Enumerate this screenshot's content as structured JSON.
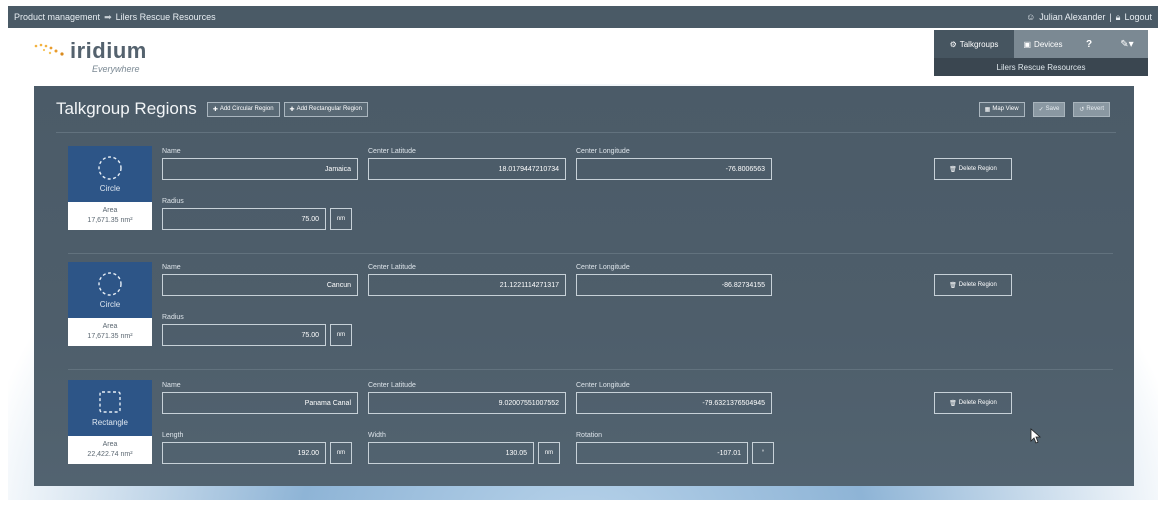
{
  "topbar": {
    "breadcrumb_left": "Product management",
    "breadcrumb_sep": "➡",
    "breadcrumb_right": "Lilers Rescue Resources",
    "user_name": "Julian Alexander",
    "separator": "|",
    "logout": "Logout"
  },
  "logo": {
    "brand": "iridium",
    "tagline": "Everywhere"
  },
  "nav": {
    "tabs": [
      {
        "label": "Talkgroups",
        "icon": "gear-icon"
      },
      {
        "label": "Devices",
        "icon": "devices-icon"
      },
      {
        "label": "",
        "icon": "help-icon"
      },
      {
        "label": "",
        "icon": "wrench-icon"
      }
    ],
    "context": "Lilers Rescue Resources"
  },
  "panel": {
    "title": "Talkgroup Regions",
    "add_circular": "Add Circular Region",
    "add_rectangular": "Add Rectangular Region",
    "map_view": "Map View",
    "save": "Save",
    "revert": "Revert"
  },
  "labels": {
    "name": "Name",
    "center_latitude": "Center Latitude",
    "center_longitude": "Center Longitude",
    "radius": "Radius",
    "length": "Length",
    "width": "Width",
    "rotation": "Rotation",
    "area": "Area",
    "delete_region": "Delete Region",
    "unit_nm": "nm",
    "unit_deg": "°"
  },
  "regions": [
    {
      "shape": "Circle",
      "area": "17,671.35 nm²",
      "name": "Jamaica",
      "center_latitude": "18.0179447210734",
      "center_longitude": "-76.8006563",
      "radius": "75.00"
    },
    {
      "shape": "Circle",
      "area": "17,671.35 nm²",
      "name": "Cancun",
      "center_latitude": "21.1221114271317",
      "center_longitude": "-86.82734155",
      "radius": "75.00"
    },
    {
      "shape": "Rectangle",
      "area": "22,422.74 nm²",
      "name": "Panama Canal",
      "center_latitude": "9.02007551007552",
      "center_longitude": "-79.6321376504945",
      "length": "192.00",
      "width": "130.05",
      "rotation": "-107.01"
    }
  ]
}
